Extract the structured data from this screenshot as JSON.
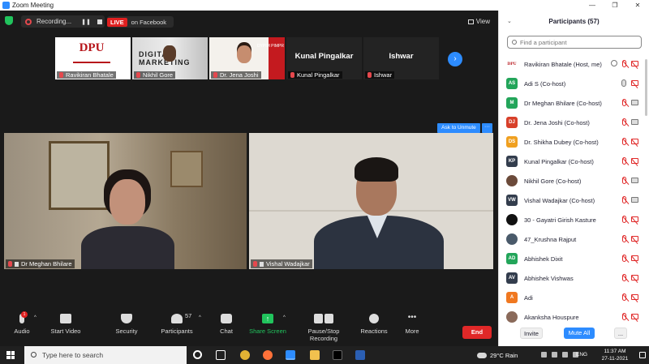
{
  "window": {
    "title": "Zoom Meeting",
    "controls": [
      "—",
      "❐",
      "✕"
    ]
  },
  "topbar": {
    "recording_label": "Recording...",
    "live_label": "LIVE",
    "live_destination": "on Facebook",
    "view_label": "View"
  },
  "thumbnails": [
    {
      "name": "Ravikiran Bhatale",
      "logo_text": "DPU"
    },
    {
      "name": "Nikhil Gore",
      "bg_text": "DIGITAL MARKETING"
    },
    {
      "name": "Dr. Jena Joshi",
      "side_text": "DYPIM PIMPR"
    },
    {
      "name": "Kunal Pingalkar",
      "display_name": "Kunal Pingalkar"
    },
    {
      "name": "Ishwar",
      "display_name": "Ishwar"
    }
  ],
  "main_videos": {
    "left": {
      "name": "Dr Meghan Bhilare"
    },
    "right": {
      "name": "Vishal Wadajkar",
      "ask_to_unmute": "Ask to Unmute",
      "more": "···"
    }
  },
  "toolbar": {
    "audio": "Audio",
    "audio_badge": "1",
    "video": "Start Video",
    "security": "Security",
    "participants": "Participants",
    "participants_count": "57",
    "chat": "Chat",
    "share": "Share Screen",
    "record": "Pause/Stop Recording",
    "reactions": "Reactions",
    "more": "More",
    "end": "End"
  },
  "panel": {
    "title": "Participants (57)",
    "search_placeholder": "Find a participant",
    "participants": [
      {
        "name": "Ravikiran Bhatale (Host, me)",
        "initials": "DPU",
        "color": "#ffffff",
        "logo": true,
        "icons": [
          "rec",
          "mutedmic",
          "mutedcam"
        ]
      },
      {
        "name": "Adi S (Co-host)",
        "initials": "AS",
        "color": "#23a55a",
        "icons": [
          "mic",
          "mutedcam"
        ]
      },
      {
        "name": "Dr Meghan Bhilare (Co-host)",
        "initials": "M",
        "color": "#23a55a",
        "icons": [
          "mutedmic",
          "cam"
        ]
      },
      {
        "name": "Dr. Jena Joshi (Co-host)",
        "initials": "DJ",
        "color": "#d8402a",
        "icons": [
          "mutedmic",
          "cam"
        ]
      },
      {
        "name": "Dr. Shikha Dubey (Co-host)",
        "initials": "DS",
        "color": "#f0a020",
        "icons": [
          "mutedmic",
          "mutedcam"
        ]
      },
      {
        "name": "Kunal Pingalkar (Co-host)",
        "initials": "KP",
        "color": "#333d4d",
        "icons": [
          "mutedmic",
          "mutedcam"
        ]
      },
      {
        "name": "Nikhil Gore (Co-host)",
        "initials": "",
        "color": "#6b4a3a",
        "icons": [
          "mutedmic",
          "cam"
        ]
      },
      {
        "name": "Vishal Wadajkar (Co-host)",
        "initials": "VW",
        "color": "#333d4d",
        "icons": [
          "mutedmic",
          "cam"
        ]
      },
      {
        "name": "30 - Gayatri Girish Kasture",
        "initials": "",
        "color": "#111111",
        "icons": [
          "mutedmic",
          "mutedcam"
        ]
      },
      {
        "name": "47_Krushna Rajput",
        "initials": "",
        "color": "#4a5a6a",
        "icons": [
          "mutedmic",
          "mutedcam"
        ]
      },
      {
        "name": "Abhishek Dixit",
        "initials": "AD",
        "color": "#23a55a",
        "icons": [
          "mutedmic",
          "mutedcam"
        ]
      },
      {
        "name": "Abhishek Vishwas",
        "initials": "AV",
        "color": "#333d4d",
        "icons": [
          "mutedmic",
          "mutedcam"
        ]
      },
      {
        "name": "Adi",
        "initials": "A",
        "color": "#f07820",
        "icons": [
          "mutedmic",
          "mutedcam"
        ]
      },
      {
        "name": "Akanksha Houspure",
        "initials": "",
        "color": "#8a6a5a",
        "icons": [
          "mutedmic",
          "mutedcam"
        ]
      }
    ],
    "invite": "Invite",
    "mute_all": "Mute All",
    "more": "..."
  },
  "taskbar": {
    "search_placeholder": "Type here to search",
    "weather": "29°C Rain",
    "language": "ENG",
    "time": "11:37 AM",
    "date": "27-11-2021"
  }
}
